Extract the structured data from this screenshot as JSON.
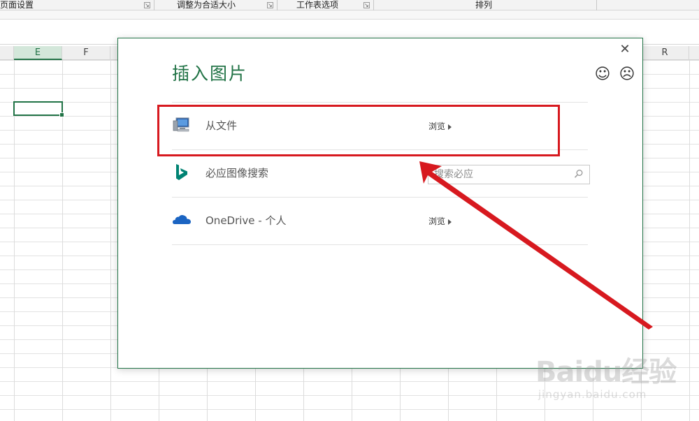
{
  "ribbon": {
    "groups": [
      "页面设置",
      "调整为合适大小",
      "工作表选项",
      "排列"
    ]
  },
  "sheet": {
    "columns": [
      "E",
      "F",
      "R"
    ],
    "active_column": "E",
    "accent_color": "#217346"
  },
  "dialog": {
    "title": "插入图片",
    "close_glyph": "✕",
    "feedback": {
      "happy": "☺",
      "sad": "☹"
    },
    "rows": [
      {
        "label": "从文件",
        "action": "浏览",
        "icon": "computer-icon"
      },
      {
        "label": "必应图像搜索",
        "search_placeholder": "搜索必应",
        "icon": "bing-icon"
      },
      {
        "label": "OneDrive - 个人",
        "action": "浏览",
        "icon": "onedrive-icon"
      }
    ]
  },
  "annotation": {
    "color": "#d7191f"
  },
  "watermark": {
    "logo_text": "Baidu经验",
    "url": "jingyan.baidu.com"
  }
}
